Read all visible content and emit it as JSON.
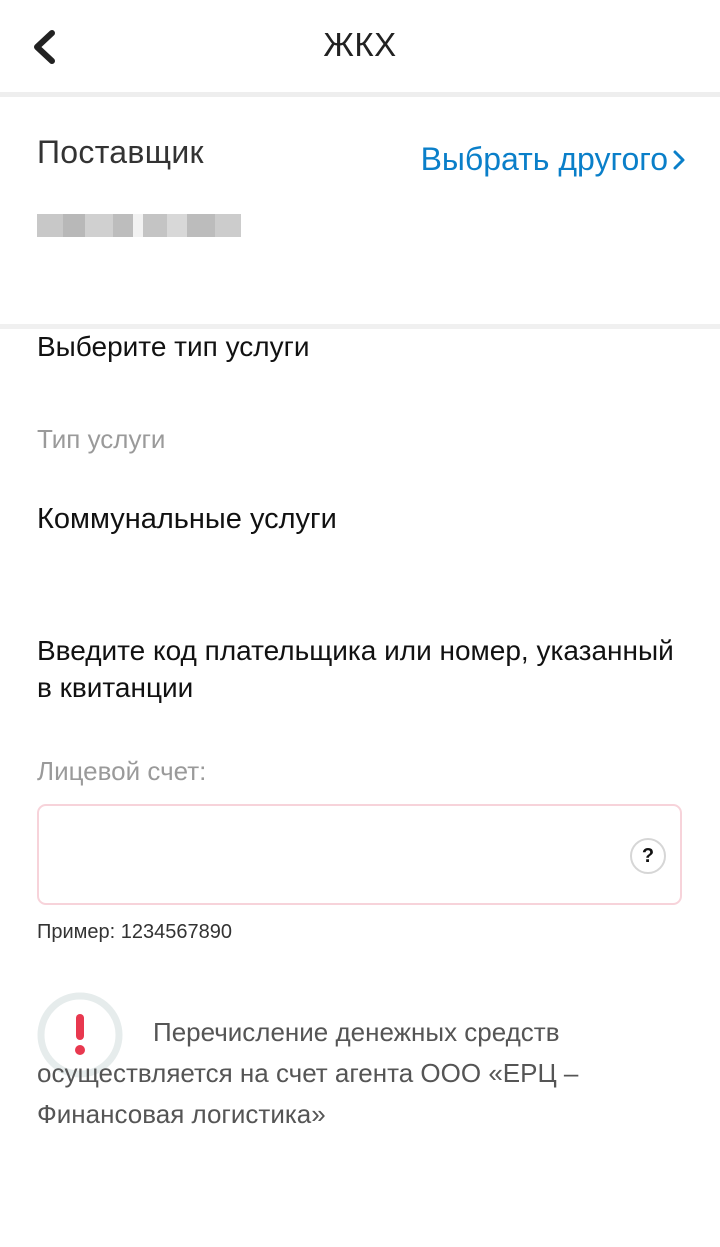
{
  "header": {
    "title": "ЖКХ",
    "back_icon": "chevron-left-icon"
  },
  "supplier": {
    "label": "Поставщик",
    "choose_other_label": "Выбрать другого",
    "choose_other_icon": "chevron-right-icon",
    "accent_color": "#0a7fc9"
  },
  "service": {
    "section_title": "Выберите тип услуги",
    "field_label": "Тип услуги",
    "value": "Коммунальные услуги"
  },
  "account": {
    "section_title": "Введите код плательщика или номер, указанный в квитанции",
    "field_label": "Лицевой счет:",
    "value": "",
    "help_symbol": "?",
    "example": "Пример: 1234567890"
  },
  "notice": {
    "icon": "exclamation-icon",
    "icon_color": "#e8384f",
    "text": "Перечисление денежных средств осуществляется на счет агента ООО «ЕРЦ – Финансовая логистика»"
  }
}
